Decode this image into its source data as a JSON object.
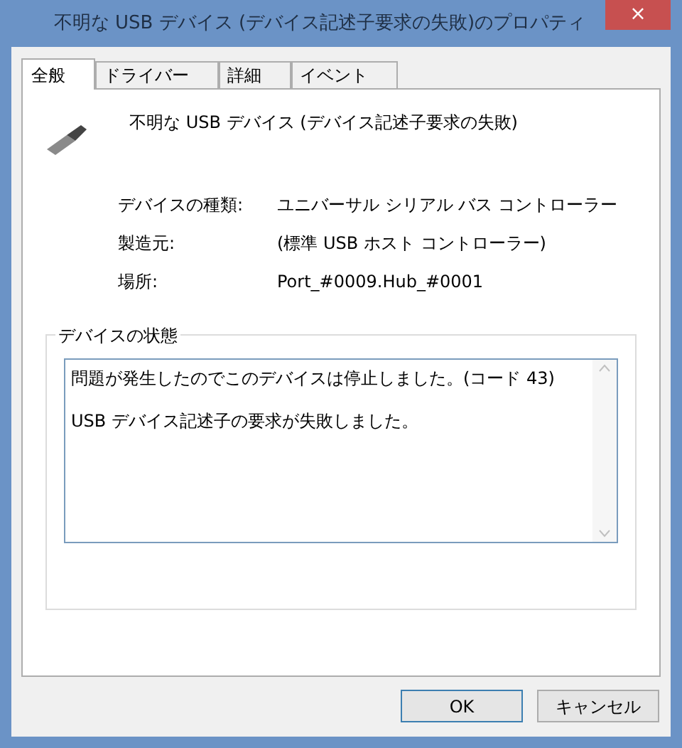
{
  "window": {
    "title": "不明な USB デバイス (デバイス記述子要求の失敗)のプロパティ",
    "close": "×"
  },
  "tabs": [
    {
      "label": "全般",
      "selected": true
    },
    {
      "label": "ドライバー",
      "selected": false
    },
    {
      "label": "詳細",
      "selected": false
    },
    {
      "label": "イベント",
      "selected": false
    }
  ],
  "device_name": "不明な USB デバイス (デバイス記述子要求の失敗)",
  "properties": [
    {
      "label": "デバイスの種類:",
      "value": "ユニバーサル シリアル バス コントローラー"
    },
    {
      "label": "製造元:",
      "value": "(標準 USB ホスト コントローラー)"
    },
    {
      "label": "場所:",
      "value": "Port_#0009.Hub_#0001"
    }
  ],
  "status_group": {
    "title": "デバイスの状態",
    "lines": [
      "問題が発生したのでこのデバイスは停止しました。(コード 43)",
      "USB デバイス記述子の要求が失敗しました。"
    ]
  },
  "buttons": [
    {
      "label": "OK",
      "default": true
    },
    {
      "label": "キャンセル",
      "default": false
    }
  ]
}
